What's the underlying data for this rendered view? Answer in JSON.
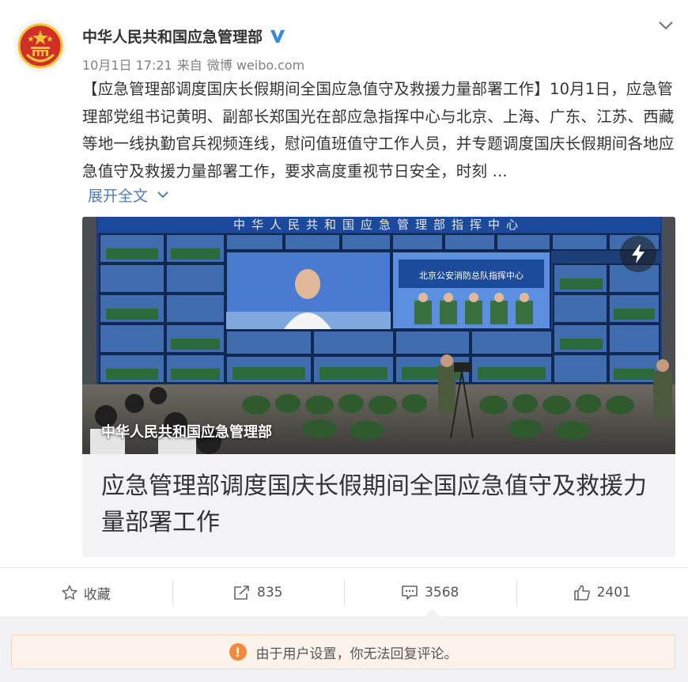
{
  "post": {
    "author": "中华人民共和国应急管理部",
    "date": "10月1日 17:21",
    "source_prefix": "来自",
    "source": "微博 weibo.com",
    "text": "【应急管理部调度国庆长假期间全国应急值守及救援力量部署工作】10月1日，应急管理部党组书记黄明、副部长郑国光在部应急指挥中心与北京、上海、广东、江苏、西藏等地一线执勤官兵视频连线，慰问值班值守工作人员，并专题调度国庆长假期间各地应急值守及救援力量部署工作，要求高度重视节日安全，时刻 ...",
    "expand_label": "展开全文",
    "icons": {
      "avatar": "national-emblem-icon",
      "verified": "verified-v-icon",
      "menu": "chevron-down-icon",
      "expand": "chevron-down-icon"
    }
  },
  "card": {
    "image_caption": "中华人民共和国应急管理部",
    "screen_banner": "中华人民共和国应急管理部指挥中心",
    "screen_panel": "北京公安消防总队指挥中心",
    "title": "应急管理部调度国庆长假期间全国应急值守及救援力量部署工作",
    "play_icon": "lightning-icon"
  },
  "actions": [
    {
      "label": "收藏",
      "icon": "star-icon"
    },
    {
      "label": "835",
      "icon": "repost-icon"
    },
    {
      "label": "3568",
      "icon": "comment-icon"
    },
    {
      "label": "2401",
      "icon": "thumbs-up-icon"
    }
  ],
  "notice": {
    "text": "由于用户设置，你无法回复评论。",
    "icon": "warning-icon"
  },
  "colors": {
    "link": "#507daf",
    "verified": "#3a89d8",
    "warning": "#f08a3e",
    "emblem_red": "#d02f28",
    "emblem_gold": "#f4c636"
  }
}
